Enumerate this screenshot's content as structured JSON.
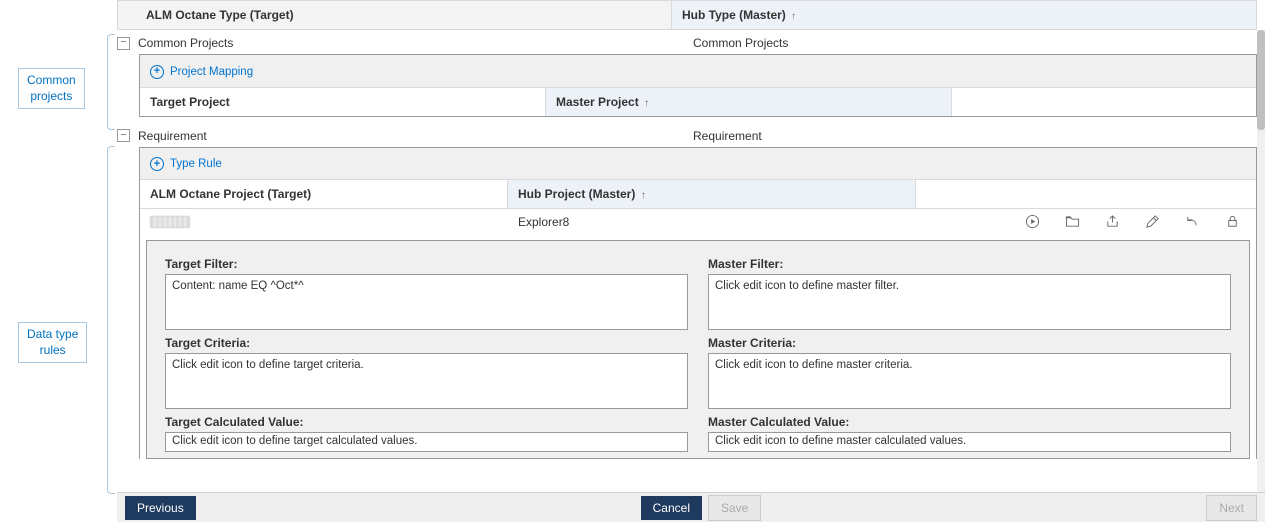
{
  "callouts": {
    "common_projects": "Common\nprojects",
    "data_type_rules": "Data type\nrules"
  },
  "headers": {
    "target": "ALM Octane Type (Target)",
    "master": "Hub Type (Master)"
  },
  "sections": {
    "common_projects": {
      "target_label": "Common Projects",
      "master_label": "Common Projects",
      "action_label": "Project Mapping",
      "sub_headers": {
        "target": "Target Project",
        "master": "Master Project"
      }
    },
    "requirement": {
      "target_label": "Requirement",
      "master_label": "Requirement",
      "action_label": "Type Rule",
      "sub_headers": {
        "target": "ALM Octane Project (Target)",
        "master": "Hub Project (Master)"
      },
      "rule_row": {
        "target": "",
        "master": "Explorer8"
      },
      "details": {
        "target_filter": {
          "label": "Target Filter:",
          "value": "Content: name EQ ^Oct*^"
        },
        "master_filter": {
          "label": "Master Filter:",
          "value": "Click edit icon to define master filter."
        },
        "target_criteria": {
          "label": "Target Criteria:",
          "value": "Click edit icon to define target criteria."
        },
        "master_criteria": {
          "label": "Master Criteria:",
          "value": "Click edit icon to define master criteria."
        },
        "target_calc": {
          "label": "Target Calculated Value:",
          "value": "Click edit icon to define target calculated values."
        },
        "master_calc": {
          "label": "Master Calculated Value:",
          "value": "Click edit icon to define master calculated values."
        }
      }
    }
  },
  "footer": {
    "previous": "Previous",
    "cancel": "Cancel",
    "save": "Save",
    "next": "Next"
  }
}
